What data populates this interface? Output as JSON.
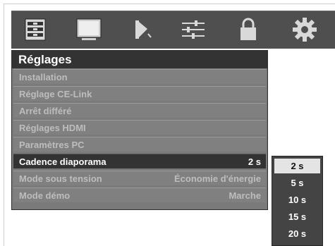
{
  "topbar": {
    "icons": [
      "installation-icon",
      "screen-icon",
      "speaker-icon",
      "sliders-icon",
      "lock-icon",
      "gear-icon"
    ],
    "background": "#4f4f4f"
  },
  "menu": {
    "title": "Réglages",
    "items": [
      {
        "label": "Installation",
        "value": ""
      },
      {
        "label": "Réglage CE-Link",
        "value": ""
      },
      {
        "label": "Arrêt différé",
        "value": ""
      },
      {
        "label": "Réglages HDMI",
        "value": ""
      },
      {
        "label": "Paramètres PC",
        "value": ""
      },
      {
        "label": "Cadence diaporama",
        "value": "2 s"
      },
      {
        "label": "Mode sous tension",
        "value": "Économie d'énergie"
      },
      {
        "label": "Mode démo",
        "value": "Marche"
      }
    ],
    "active_index": 5
  },
  "dropdown": {
    "options": [
      "2 s",
      "5 s",
      "10 s",
      "15 s",
      "20 s"
    ],
    "selected": "2 s"
  }
}
